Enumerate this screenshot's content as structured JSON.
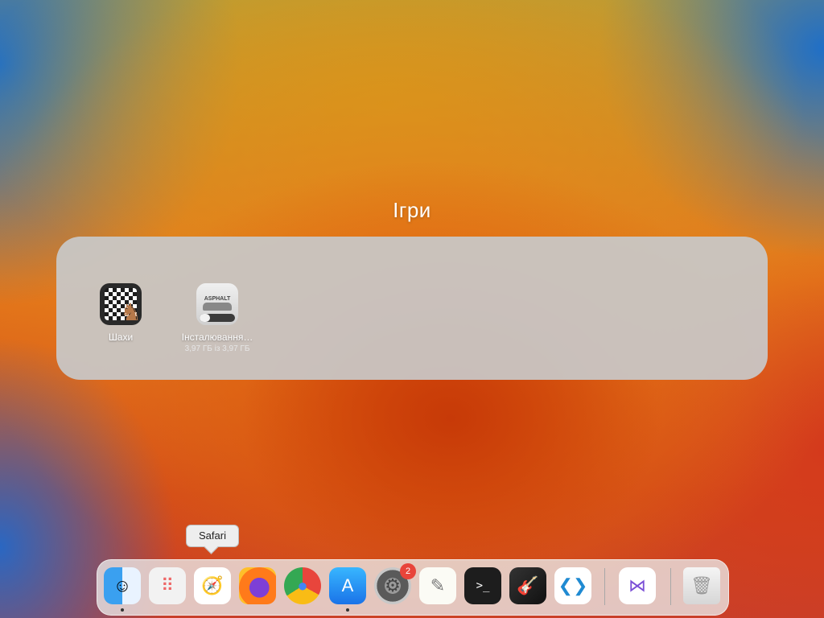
{
  "folder": {
    "title": "Ігри",
    "apps": [
      {
        "label": "Шахи",
        "icon": "chess-icon"
      },
      {
        "label": "Інсталювання…",
        "sub": "3,97 ГБ із 3,97 ГБ",
        "icon": "asphalt-icon",
        "progress": 0.3
      }
    ]
  },
  "tooltip": {
    "label": "Safari"
  },
  "dock": {
    "apps": [
      {
        "name": "Finder",
        "icon": "finder-icon",
        "running": true
      },
      {
        "name": "Launchpad",
        "icon": "launchpad-icon"
      },
      {
        "name": "Safari",
        "icon": "safari-icon"
      },
      {
        "name": "Firefox",
        "icon": "firefox-icon"
      },
      {
        "name": "Chrome",
        "icon": "chrome-icon"
      },
      {
        "name": "App Store",
        "icon": "appstore-icon",
        "running": true
      },
      {
        "name": "System Settings",
        "icon": "settings-icon",
        "badge": "2"
      },
      {
        "name": "TextEdit",
        "icon": "textedit-icon"
      },
      {
        "name": "Terminal",
        "icon": "terminal-icon"
      },
      {
        "name": "GarageBand",
        "icon": "garageband-icon"
      },
      {
        "name": "Visual Studio Code",
        "icon": "vscode-icon"
      },
      {
        "name": "Visual Studio",
        "icon": "visualstudio-icon"
      },
      {
        "name": "Trash",
        "icon": "trash-icon"
      }
    ]
  }
}
